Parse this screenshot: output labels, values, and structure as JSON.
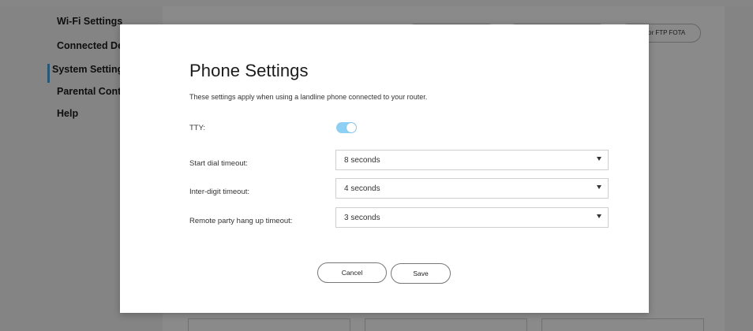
{
  "background": {
    "nav_items": [
      "Wi-Fi Settings",
      "Connected De",
      "System Settings",
      "Parental Cont",
      "Help"
    ],
    "fota_pill_text": "or FTP FOTA",
    "accent_color": "#4a9fd8"
  },
  "modal": {
    "title": "Phone Settings",
    "description": "These settings apply when using a landline phone connected to your router.",
    "tty": {
      "label": "TTY:",
      "enabled": true,
      "toggle_color": "#8dd0f3"
    },
    "start_dial_timeout": {
      "label": "Start dial timeout:",
      "value": "8 seconds"
    },
    "inter_digit_timeout": {
      "label": "Inter-digit timeout:",
      "value": "4 seconds"
    },
    "remote_hangup_timeout": {
      "label": "Remote party hang up timeout:",
      "value": "3 seconds"
    },
    "cancel_label": "Cancel",
    "save_label": "Save"
  }
}
